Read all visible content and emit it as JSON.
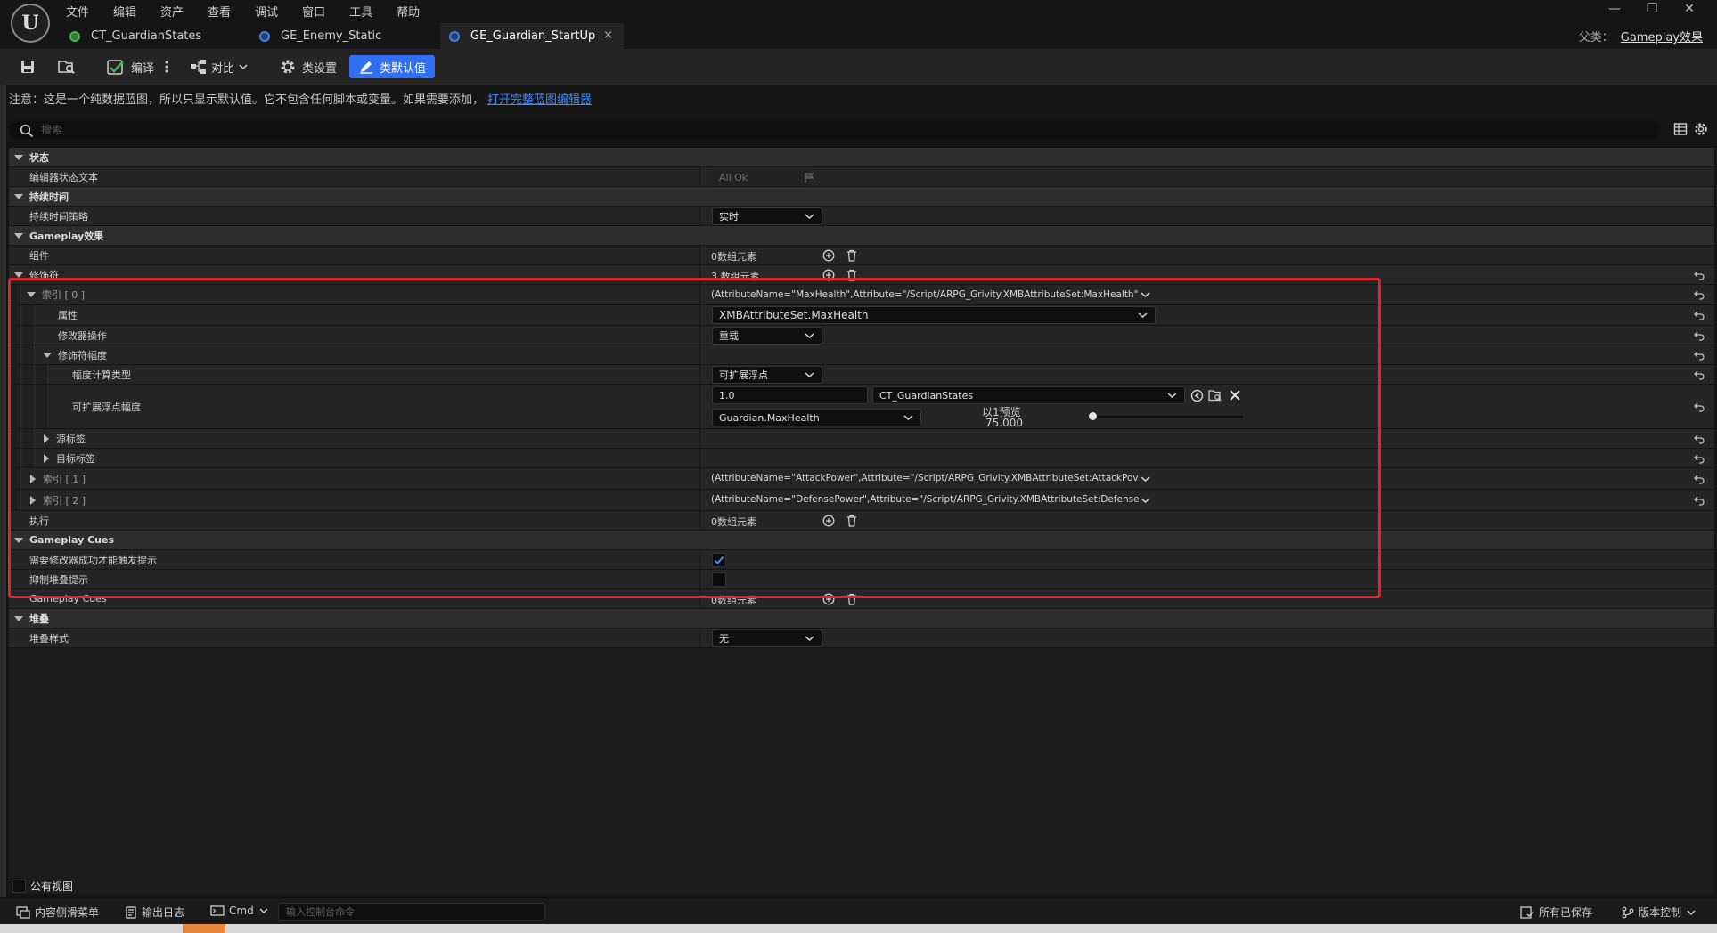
{
  "menu": [
    "文件",
    "编辑",
    "资产",
    "查看",
    "调试",
    "窗口",
    "工具",
    "帮助"
  ],
  "logo_text": "U",
  "window_controls": [
    "—",
    "❐",
    "✕"
  ],
  "tabs": [
    {
      "label": "CT_GuardianStates",
      "color": "#4caf50"
    },
    {
      "label": "GE_Enemy_Static",
      "color": "#4a7fd6"
    },
    {
      "label": "GE_Guardian_StartUp",
      "color": "#4a7fd6",
      "close": "×"
    }
  ],
  "parent": {
    "label": "父类：",
    "value": "Gameplay效果"
  },
  "toolbar": {
    "compile": "编译",
    "diff": "对比",
    "class_settings": "类设置",
    "class_defaults": "类默认值"
  },
  "notice": {
    "text": "注意：这是一个纯数据蓝图，所以只显示默认值。它不包含任何脚本或变量。如果需要添加，",
    "link": "打开完整蓝图编辑器"
  },
  "search": {
    "placeholder": "搜索"
  },
  "details": {
    "state": {
      "category": "状态",
      "editor_state_label": "编辑器状态文本",
      "editor_state_value": "All Ok"
    },
    "duration": {
      "category": "持续时间",
      "policy_label": "持续时间策略",
      "policy_value": "实时"
    },
    "gameplay_effect": {
      "category": "Gameplay效果",
      "components_label": "组件",
      "components_value": "0数组元素",
      "modifiers_label": "修饰符",
      "modifiers_value": "3 数组元素",
      "index0": {
        "label": "索引 [ 0 ]",
        "value": "(AttributeName=\"MaxHealth\",Attribute=\"/Script/ARPG_Grivity.XMBAttributeSet:MaxHealth\"",
        "attribute_label": "属性",
        "attribute_value": "XMBAttributeSet.MaxHealth",
        "op_label": "修改器操作",
        "op_value": "重载",
        "magnitude_label": "修饰符幅度",
        "calc_type_label": "幅度计算类型",
        "calc_type_value": "可扩展浮点",
        "scalable_label": "可扩展浮点幅度",
        "scalable_value": "1.0",
        "curve_table": "CT_GuardianStates",
        "curve_row": "Guardian.MaxHealth",
        "preview_label": "以1预览",
        "preview_value": "75.000",
        "preview_slider": 0,
        "source_tags": "源标签",
        "target_tags": "目标标签"
      },
      "index1": {
        "label": "索引 [ 1 ]",
        "value": "(AttributeName=\"AttackPower\",Attribute=\"/Script/ARPG_Grivity.XMBAttributeSet:AttackPov"
      },
      "index2": {
        "label": "索引 [ 2 ]",
        "value": "(AttributeName=\"DefensePower\",Attribute=\"/Script/ARPG_Grivity.XMBAttributeSet:Defense"
      },
      "executions_label": "执行",
      "executions_value": "0数组元素"
    },
    "cues": {
      "category": "Gameplay Cues",
      "require_success_label": "需要修改器成功才能触发提示",
      "require_success_checked": true,
      "suppress_stacking_label": "抑制堆叠提示",
      "suppress_stacking_checked": false,
      "cues_label": "Gameplay Cues",
      "cues_value": "0数组元素"
    },
    "stacking": {
      "category": "堆叠",
      "style_label": "堆叠样式",
      "style_value": "无"
    }
  },
  "public_view": "公有视图",
  "statusbar": {
    "content_drawer": "内容侧滑菜单",
    "output_log": "输出日志",
    "cmd": "Cmd",
    "console_placeholder": "输入控制台命令",
    "all_saved": "所有已保存",
    "source_control": "版本控制"
  }
}
